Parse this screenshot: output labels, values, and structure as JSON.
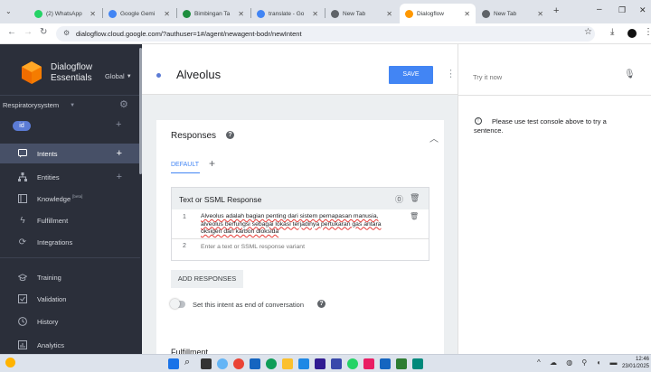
{
  "browser": {
    "tabs": [
      {
        "title": "(2) WhatsApp",
        "color": "#25d366"
      },
      {
        "title": "Google Gemi",
        "color": "#4285f4"
      },
      {
        "title": "Bimbingan Ta",
        "color": "#1e8e3e"
      },
      {
        "title": "translate - Go",
        "color": "#4285f4"
      },
      {
        "title": "New Tab",
        "color": "#5f6368"
      },
      {
        "title": "Dialogflow",
        "color": "#ff9800"
      },
      {
        "title": "New Tab",
        "color": "#5f6368"
      }
    ],
    "url": "dialogflow.cloud.google.com/?authuser=1#/agent/newagent-bodr/newIntent"
  },
  "sidebar": {
    "brand_line1": "Dialogflow",
    "brand_line2": "Essentials",
    "region": "Global",
    "agent": "Respiratorysystem",
    "lang_badge": "id",
    "items": [
      {
        "label": "Intents",
        "icon": "chat-icon"
      },
      {
        "label": "Entities",
        "icon": "hierarchy-icon"
      },
      {
        "label": "Knowledge",
        "beta": "[beta]",
        "icon": "book-icon"
      },
      {
        "label": "Fulfillment",
        "icon": "bolt-icon"
      },
      {
        "label": "Integrations",
        "icon": "integrations-icon"
      },
      {
        "label": "Training",
        "icon": "graduation-icon"
      },
      {
        "label": "Validation",
        "icon": "check-square-icon"
      },
      {
        "label": "History",
        "icon": "clock-icon"
      },
      {
        "label": "Analytics",
        "icon": "chart-icon"
      }
    ]
  },
  "main": {
    "intent_name": "Alveolus",
    "save_label": "SAVE",
    "responses_title": "Responses",
    "default_tab": "DEFAULT",
    "text_response_title": "Text or SSML Response",
    "response_line1": "Alveolus adalah bagian penting dari sistem pernapasan manusia,",
    "response_line2": "alveolus berfungsi sebagai lokasi terjadinya pertukaran gas antara",
    "response_line3": "oksigen dan karbon dioksida",
    "row1_num": "1",
    "row2_num": "2",
    "new_variant_placeholder": "Enter a text or SSML response variant",
    "add_responses_label": "ADD RESPONSES",
    "end_conversation_label": "Set this intent as end of conversation",
    "fulfillment_title": "Fulfillment"
  },
  "try_panel": {
    "placeholder": "Try it now",
    "hint": "Please use test console above to try a sentence."
  },
  "taskbar": {
    "time": "12:46",
    "date": "23/01/2025"
  }
}
